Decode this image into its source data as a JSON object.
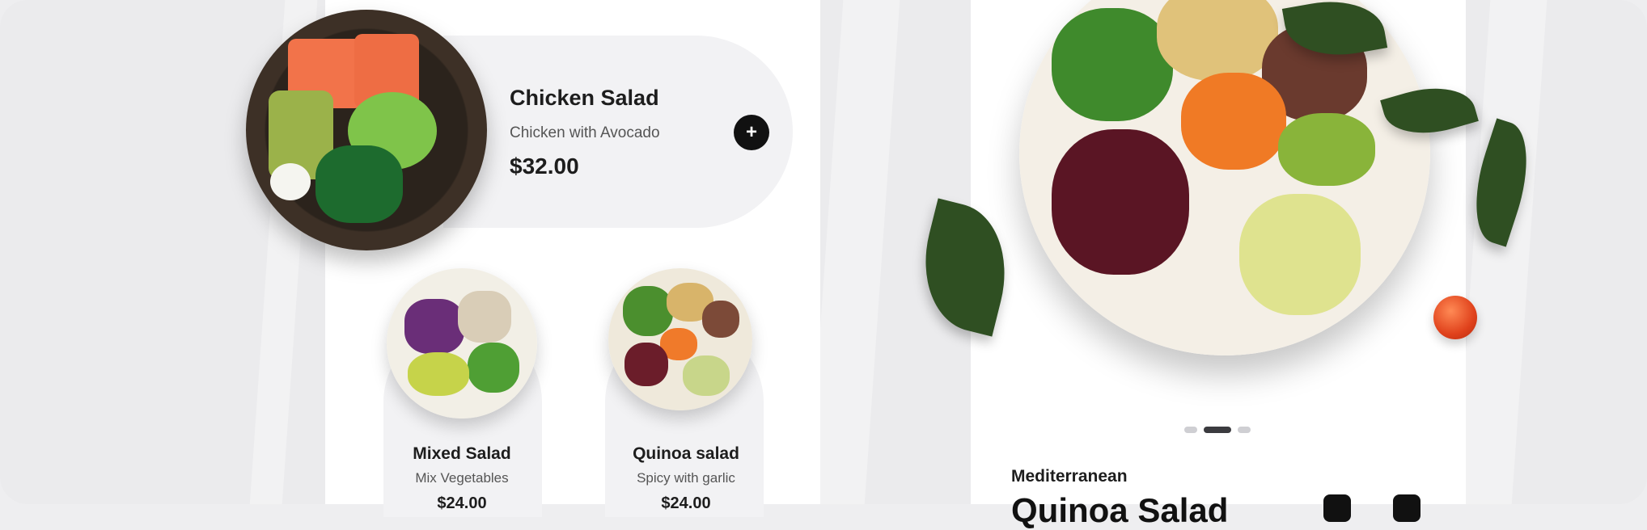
{
  "featured": {
    "title": "Chicken Salad",
    "subtitle": "Chicken with Avocado",
    "price": "$32.00",
    "add_icon": "plus-icon",
    "add_label": "+"
  },
  "small_cards": [
    {
      "title": "Mixed Salad",
      "subtitle": "Mix Vegetables",
      "price": "$24.00"
    },
    {
      "title": "Quinoa salad",
      "subtitle": "Spicy with garlic",
      "price": "$24.00"
    }
  ],
  "hero": {
    "category": "Mediterranean",
    "title": "Quinoa Salad",
    "carousel": {
      "count": 3,
      "active_index": 1
    }
  },
  "colors": {
    "background": "#ebebed",
    "card": "#f2f2f4",
    "text": "#1d1d1d",
    "accent": "#111111"
  }
}
